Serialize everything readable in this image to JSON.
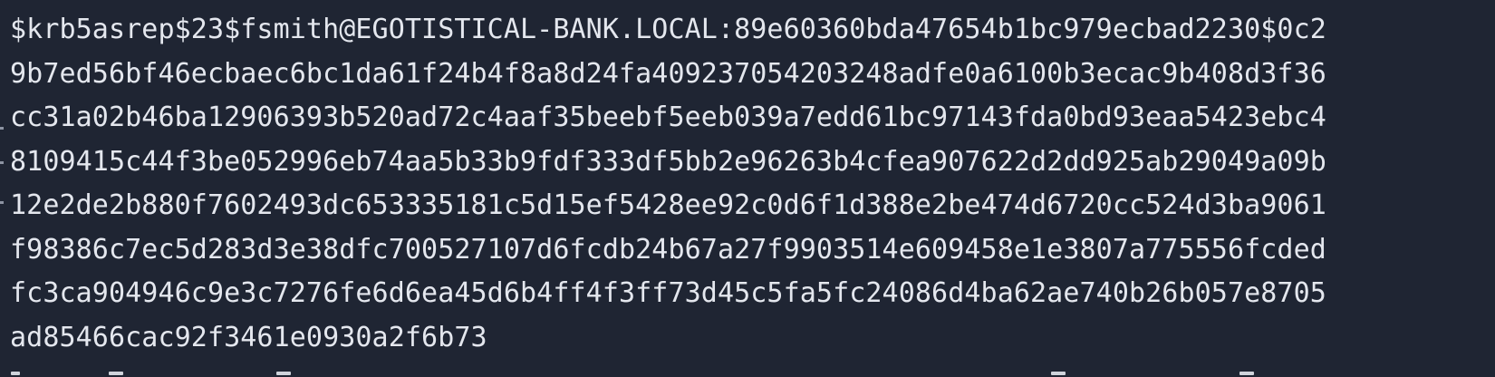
{
  "terminal": {
    "output_lines": [
      "$krb5asrep$23$fsmith@EGOTISTICAL-BANK.LOCAL:89e60360bda47654b1bc979ecbad2230$0c2",
      "9b7ed56bf46ecbaec6bc1da61f24b4f8a8d24fa409237054203248adfe0a6100b3ecac9b408d3f36",
      "cc31a02b46ba12906393b520ad72c4aaf35beebf5eeb039a7edd61bc97143fda0bd93eaa5423ebc4",
      "8109415c44f3be052996eb74aa5b33b9fdf333df5bb2e96263b4cfea907622d2dd925ab29049a09b",
      "12e2de2b880f7602493dc653335181c5d15ef5428ee92c0d6f1d388e2be474d6720cc524d3ba9061",
      "f98386c7ec5d283d3e38dfc700527107d6fcdb24b67a27f9903514e609458e1e3807a775556fcded",
      "fc3ca904946c9e3c7276fe6d6ea45d6b4ff4f3ff73d45c5fa5fc24086d4ba62ae740b26b057e8705",
      "ad85466cac92f3461e0930a2f6b73"
    ]
  },
  "colors": {
    "background": "#1f2533",
    "foreground": "#e4e7ee"
  }
}
